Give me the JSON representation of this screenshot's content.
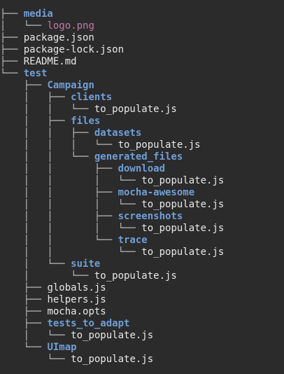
{
  "root_mark": ".",
  "colors": {
    "background": "#2b2b2b",
    "directory": "#6f9fd8",
    "image_file": "#c678a8",
    "file": "#e8e8e8",
    "guides": "#bfbfbf"
  },
  "tree_lines": [
    {
      "prefix": "├── ",
      "name": "media",
      "kind": "dir"
    },
    {
      "prefix": "│   └── ",
      "name": "logo.png",
      "kind": "image"
    },
    {
      "prefix": "├── ",
      "name": "package.json",
      "kind": "file"
    },
    {
      "prefix": "├── ",
      "name": "package-lock.json",
      "kind": "file"
    },
    {
      "prefix": "├── ",
      "name": "README.md",
      "kind": "file"
    },
    {
      "prefix": "└── ",
      "name": "test",
      "kind": "dir"
    },
    {
      "prefix": "    ├── ",
      "name": "Campaign",
      "kind": "dir"
    },
    {
      "prefix": "    │   ├── ",
      "name": "clients",
      "kind": "dir"
    },
    {
      "prefix": "    │   │   └── ",
      "name": "to_populate.js",
      "kind": "file"
    },
    {
      "prefix": "    │   ├── ",
      "name": "files",
      "kind": "dir"
    },
    {
      "prefix": "    │   │   ├── ",
      "name": "datasets",
      "kind": "dir"
    },
    {
      "prefix": "    │   │   │   └── ",
      "name": "to_populate.js",
      "kind": "file"
    },
    {
      "prefix": "    │   │   └── ",
      "name": "generated_files",
      "kind": "dir"
    },
    {
      "prefix": "    │   │       ├── ",
      "name": "download",
      "kind": "dir"
    },
    {
      "prefix": "    │   │       │   └── ",
      "name": "to_populate.js",
      "kind": "file"
    },
    {
      "prefix": "    │   │       ├── ",
      "name": "mocha-awesome",
      "kind": "dir"
    },
    {
      "prefix": "    │   │       │   └── ",
      "name": "to_populate.js",
      "kind": "file"
    },
    {
      "prefix": "    │   │       ├── ",
      "name": "screenshots",
      "kind": "dir"
    },
    {
      "prefix": "    │   │       │   └── ",
      "name": "to_populate.js",
      "kind": "file"
    },
    {
      "prefix": "    │   │       └── ",
      "name": "trace",
      "kind": "dir"
    },
    {
      "prefix": "    │   │           └── ",
      "name": "to_populate.js",
      "kind": "file"
    },
    {
      "prefix": "    │   └── ",
      "name": "suite",
      "kind": "dir"
    },
    {
      "prefix": "    │       └── ",
      "name": "to_populate.js",
      "kind": "file"
    },
    {
      "prefix": "    ├── ",
      "name": "globals.js",
      "kind": "file"
    },
    {
      "prefix": "    ├── ",
      "name": "helpers.js",
      "kind": "file"
    },
    {
      "prefix": "    ├── ",
      "name": "mocha.opts",
      "kind": "file"
    },
    {
      "prefix": "    ├── ",
      "name": "tests_to_adapt",
      "kind": "dir"
    },
    {
      "prefix": "    │   └── ",
      "name": "to_populate.js",
      "kind": "file"
    },
    {
      "prefix": "    └── ",
      "name": "UImap",
      "kind": "dir"
    },
    {
      "prefix": "        └── ",
      "name": "to_populate.js",
      "kind": "file"
    }
  ]
}
